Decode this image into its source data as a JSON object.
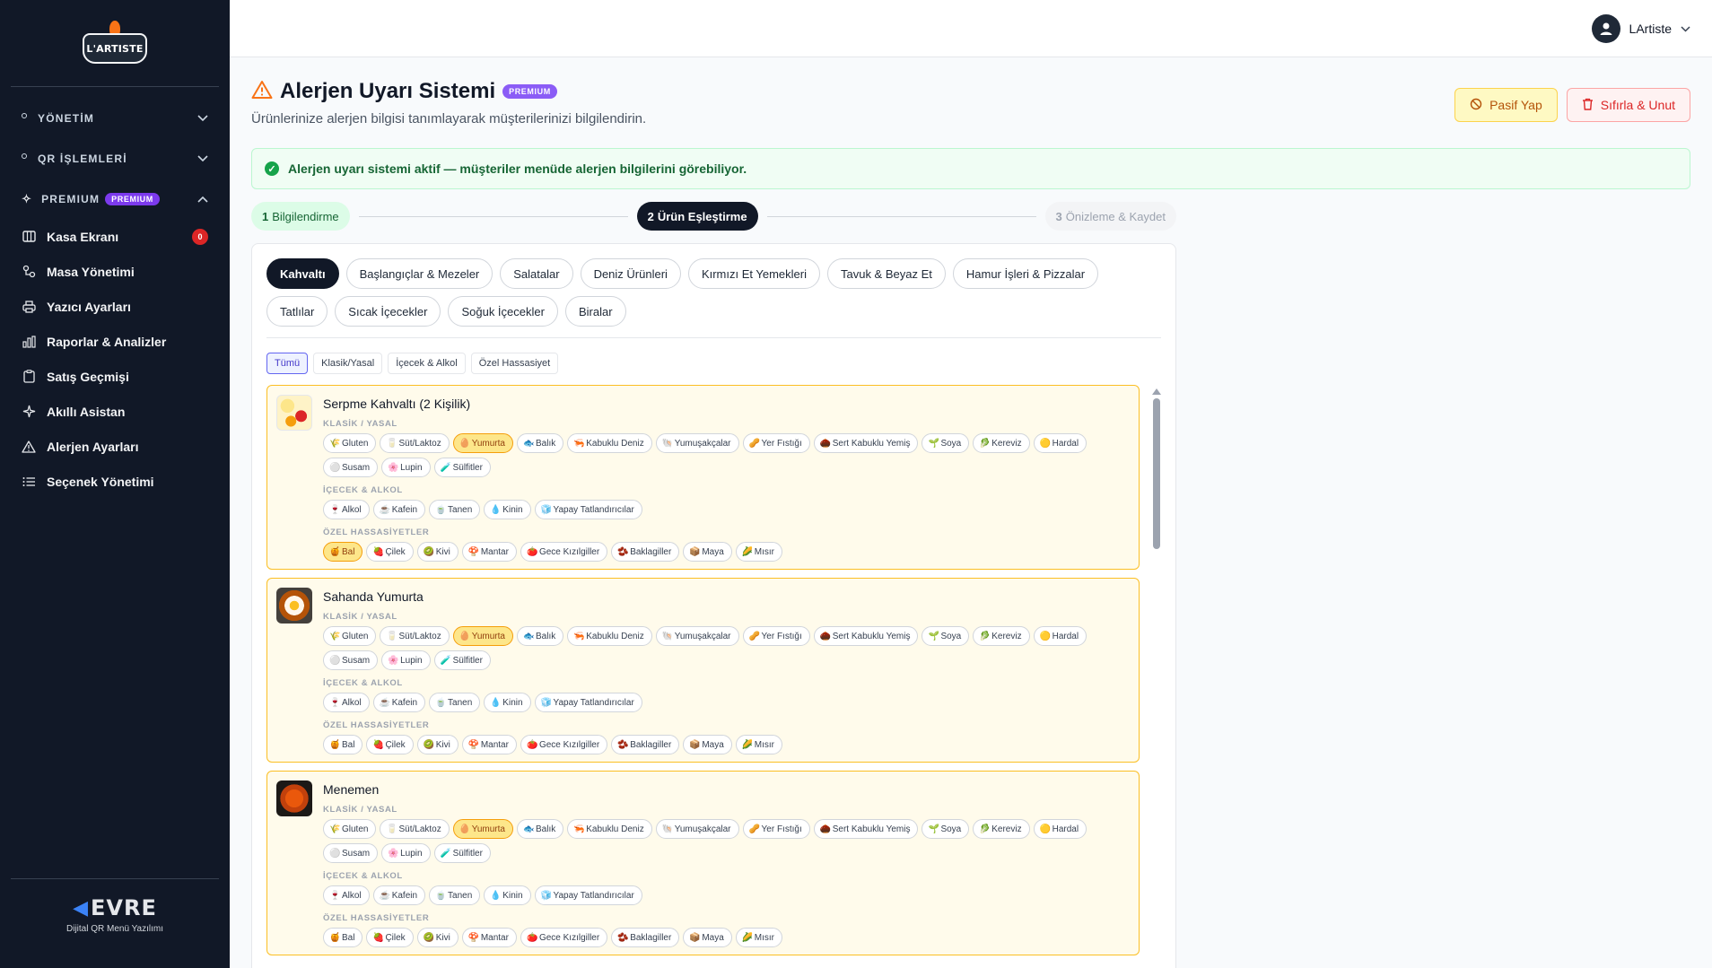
{
  "sidebar": {
    "logo_text": "L'ARTISTE",
    "sections": [
      {
        "label": "YÖNETİM"
      },
      {
        "label": "QR İŞLEMLERİ"
      },
      {
        "label": "PREMIUM",
        "badge": "PREMIUM"
      }
    ],
    "items": [
      {
        "label": "Kasa Ekranı",
        "icon": "columns-icon",
        "count": "0"
      },
      {
        "label": "Masa Yönetimi",
        "icon": "nodes-icon"
      },
      {
        "label": "Yazıcı Ayarları",
        "icon": "printer-icon"
      },
      {
        "label": "Raporlar & Analizler",
        "icon": "bar-chart-icon"
      },
      {
        "label": "Satış Geçmişi",
        "icon": "clipboard-icon"
      },
      {
        "label": "Akıllı Asistan",
        "icon": "sparkle-icon"
      },
      {
        "label": "Alerjen Ayarları",
        "icon": "warning-icon"
      },
      {
        "label": "Seçenek Yönetimi",
        "icon": "list-icon"
      }
    ],
    "footer": {
      "brand": "EVRE",
      "tagline": "Dijital QR Menü Yazılımı"
    }
  },
  "topbar": {
    "user_name": "LArtiste"
  },
  "page": {
    "title": "Alerjen Uyarı Sistemi",
    "premium_tag": "PREMIUM",
    "subtitle": "Ürünlerinize alerjen bilgisi tanımlayarak müşterilerinizi bilgilendirin.",
    "btn_passive": "Pasif Yap",
    "btn_reset": "Sıfırla & Unut",
    "alert": "Alerjen uyarı sistemi aktif — müşteriler menüde alerjen bilgilerini görebiliyor."
  },
  "steps": [
    {
      "num": "1",
      "label": "Bilgilendirme",
      "state": "done"
    },
    {
      "num": "2",
      "label": "Ürün Eşleştirme",
      "state": "active"
    },
    {
      "num": "3",
      "label": "Önizleme & Kaydet",
      "state": "todo"
    }
  ],
  "categories": [
    "Kahvaltı",
    "Başlangıçlar & Mezeler",
    "Salatalar",
    "Deniz Ürünleri",
    "Kırmızı Et Yemekleri",
    "Tavuk & Beyaz Et",
    "Hamur İşleri & Pizzalar",
    "Tatlılar",
    "Sıcak İçecekler",
    "Soğuk İçecekler",
    "Biralar"
  ],
  "active_category": "Kahvaltı",
  "filters": [
    "Tümü",
    "Klasik/Yasal",
    "İçecek & Alkol",
    "Özel Hassasiyet"
  ],
  "active_filter": "Tümü",
  "group_labels": {
    "classic": "KLASİK / YASAL",
    "drinks": "İÇECEK & ALKOL",
    "special": "ÖZEL HASSASİYETLER"
  },
  "allergens": {
    "classic": [
      {
        "label": "Gluten",
        "icon": "🌾"
      },
      {
        "label": "Süt/Laktoz",
        "icon": "🥛"
      },
      {
        "label": "Yumurta",
        "icon": "🥚"
      },
      {
        "label": "Balık",
        "icon": "🐟"
      },
      {
        "label": "Kabuklu Deniz",
        "icon": "🦐"
      },
      {
        "label": "Yumuşakçalar",
        "icon": "🐚"
      },
      {
        "label": "Yer Fıstığı",
        "icon": "🥜"
      },
      {
        "label": "Sert Kabuklu Yemiş",
        "icon": "🌰"
      },
      {
        "label": "Soya",
        "icon": "🌱"
      },
      {
        "label": "Kereviz",
        "icon": "🥬"
      },
      {
        "label": "Hardal",
        "icon": "🟡"
      },
      {
        "label": "Susam",
        "icon": "⚪"
      },
      {
        "label": "Lupin",
        "icon": "🌸"
      },
      {
        "label": "Sülfitler",
        "icon": "🧪"
      }
    ],
    "drinks": [
      {
        "label": "Alkol",
        "icon": "🍷"
      },
      {
        "label": "Kafein",
        "icon": "☕"
      },
      {
        "label": "Tanen",
        "icon": "🍵"
      },
      {
        "label": "Kinin",
        "icon": "💧"
      },
      {
        "label": "Yapay Tatlandırıcılar",
        "icon": "🧊"
      }
    ],
    "special": [
      {
        "label": "Bal",
        "icon": "🍯"
      },
      {
        "label": "Çilek",
        "icon": "🍓"
      },
      {
        "label": "Kivi",
        "icon": "🥝"
      },
      {
        "label": "Mantar",
        "icon": "🍄"
      },
      {
        "label": "Gece Kızılgiller",
        "icon": "🍅"
      },
      {
        "label": "Baklagiller",
        "icon": "🫘"
      },
      {
        "label": "Maya",
        "icon": "📦"
      },
      {
        "label": "Mısır",
        "icon": "🌽"
      }
    ]
  },
  "products": [
    {
      "name": "Serpme Kahvaltı (2 Kişilik)",
      "selected": [
        "Yumurta",
        "Bal"
      ]
    },
    {
      "name": "Sahanda Yumurta",
      "selected": [
        "Yumurta"
      ]
    },
    {
      "name": "Menemen",
      "selected": [
        "Yumurta"
      ]
    }
  ],
  "colors": {
    "sidebar_bg": "#111827",
    "accent_premium": "#7c3aed",
    "card_border": "#fbbf24",
    "card_bg": "#fffbeb",
    "selected_chip": "#fde68a"
  }
}
